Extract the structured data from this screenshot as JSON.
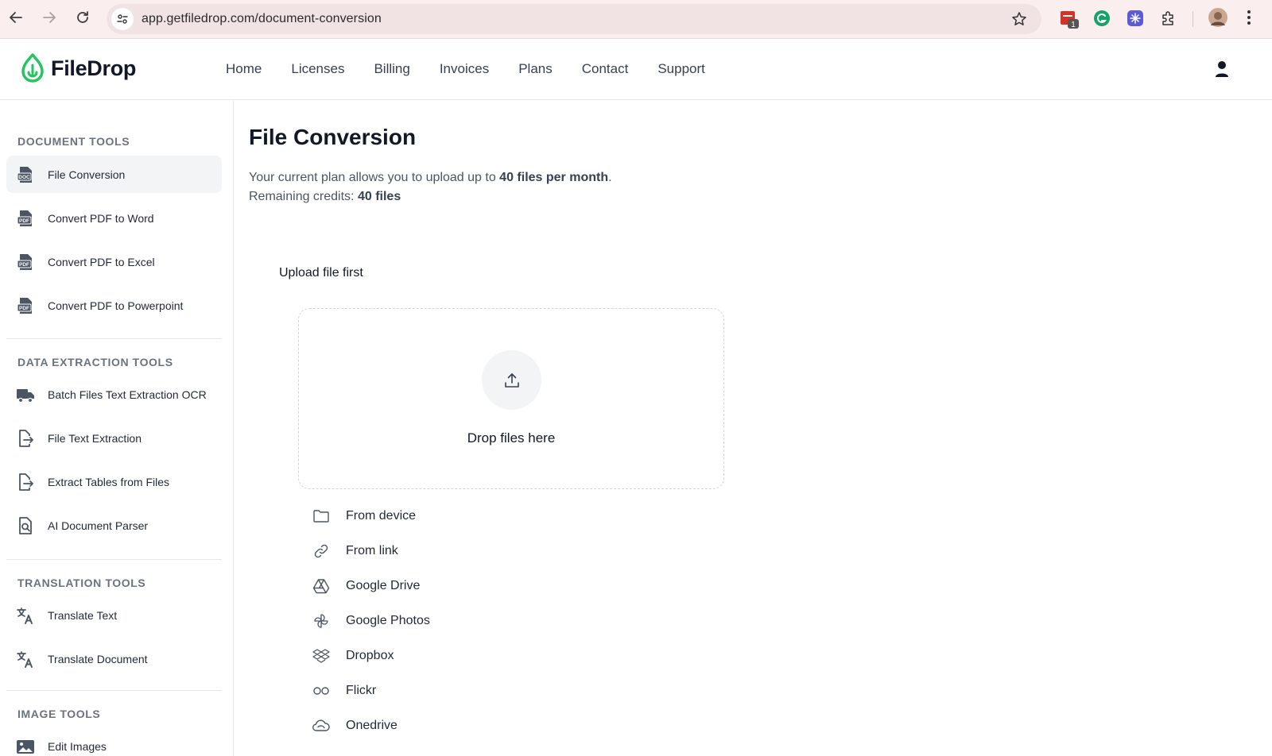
{
  "browser": {
    "url": "app.getfiledrop.com/document-conversion",
    "extension_badge": "1"
  },
  "brand": {
    "name": "FileDrop",
    "color": "#22c55e"
  },
  "topnav": [
    "Home",
    "Licenses",
    "Billing",
    "Invoices",
    "Plans",
    "Contact",
    "Support"
  ],
  "sidebar": {
    "document_tools": {
      "title": "DOCUMENT TOOLS",
      "items": [
        {
          "label": "File Conversion",
          "icon": "doc-file-icon"
        },
        {
          "label": "Convert PDF to Word",
          "icon": "pdf-file-icon"
        },
        {
          "label": "Convert PDF to Excel",
          "icon": "pdf-file-icon"
        },
        {
          "label": "Convert PDF to Powerpoint",
          "icon": "pdf-file-icon"
        }
      ]
    },
    "data_extraction": {
      "title": "DATA EXTRACTION TOOLS",
      "items": [
        {
          "label": "Batch Files Text Extraction OCR",
          "icon": "truck-icon"
        },
        {
          "label": "File Text Extraction",
          "icon": "file-export-icon"
        },
        {
          "label": "Extract Tables from Files",
          "icon": "file-export-icon"
        },
        {
          "label": "AI Document Parser",
          "icon": "file-search-icon"
        }
      ]
    },
    "translation": {
      "title": "TRANSLATION TOOLS",
      "items": [
        {
          "label": "Translate Text",
          "icon": "translate-icon"
        },
        {
          "label": "Translate Document",
          "icon": "translate-icon"
        }
      ]
    },
    "image": {
      "title": "IMAGE TOOLS",
      "items": [
        {
          "label": "Edit Images",
          "icon": "image-icon"
        }
      ]
    }
  },
  "main": {
    "title": "File Conversion",
    "plan_prefix": "Your current plan allows you to upload up to ",
    "plan_limit": "40 files per month",
    "plan_suffix": ".",
    "credits_prefix": "Remaining credits: ",
    "credits_value": "40 files",
    "upload_heading": "Upload file first",
    "drop_text": "Drop files here",
    "sources": [
      {
        "label": "From device",
        "icon": "folder-icon"
      },
      {
        "label": "From link",
        "icon": "link-icon"
      },
      {
        "label": "Google Drive",
        "icon": "google-drive-icon"
      },
      {
        "label": "Google Photos",
        "icon": "google-photos-icon"
      },
      {
        "label": "Dropbox",
        "icon": "dropbox-icon"
      },
      {
        "label": "Flickr",
        "icon": "flickr-icon"
      },
      {
        "label": "Onedrive",
        "icon": "onedrive-icon"
      }
    ]
  }
}
